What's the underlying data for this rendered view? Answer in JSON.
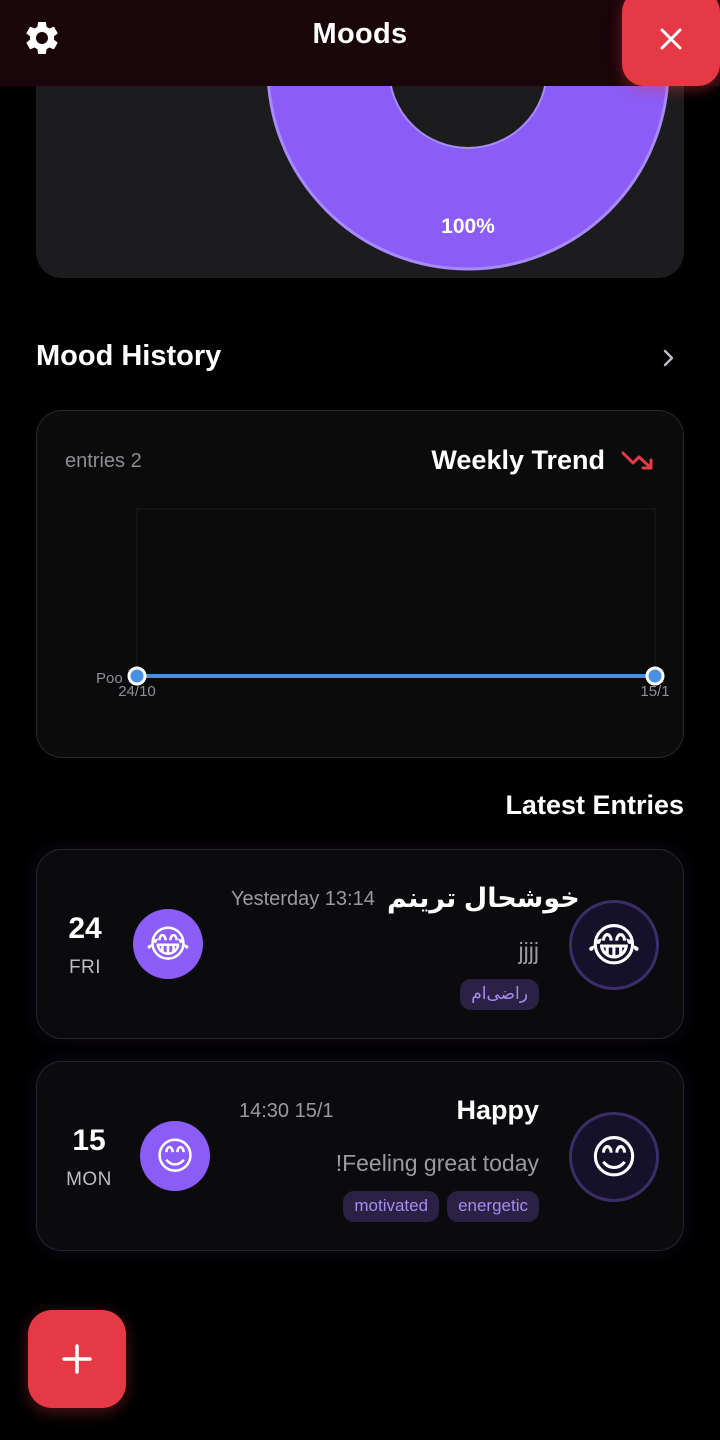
{
  "header": {
    "title": "Moods",
    "settings_icon": "gear-icon",
    "close_icon": "close-icon"
  },
  "distribution": {
    "percent_label": "100%",
    "share": 1.0,
    "color": "#8b5cf6"
  },
  "history": {
    "title": "Mood History",
    "chevron_icon": "chevron-right-icon"
  },
  "weekly_trend": {
    "title": "Weekly Trend",
    "entries_label": "entries 2",
    "trend_icon": "trending-down-icon",
    "trend_color": "#e53946",
    "chart_data": {
      "type": "line",
      "x": [
        "24/10",
        "15/1"
      ],
      "series": [
        {
          "values": [
            1,
            1
          ],
          "color": "#4a90e2"
        }
      ],
      "y_tick_label": "Poo",
      "x_tick_labels": [
        "24/10",
        "15/1"
      ]
    }
  },
  "latest": {
    "title": "Latest Entries",
    "entries": [
      {
        "date_num": "24",
        "date_day": "FRI",
        "time": "Yesterday 13:14",
        "mood": "خوشحال ترینم",
        "note": "jjjj",
        "emoji": "😂",
        "tags": [
          "راضی‌ام"
        ]
      },
      {
        "date_num": "15",
        "date_day": "MON",
        "time": "14:30 15/1",
        "mood": "Happy",
        "note": "!Feeling great today",
        "emoji": "😊",
        "tags": [
          "energetic",
          "motivated"
        ]
      }
    ]
  },
  "fab": {
    "icon": "plus-icon"
  }
}
